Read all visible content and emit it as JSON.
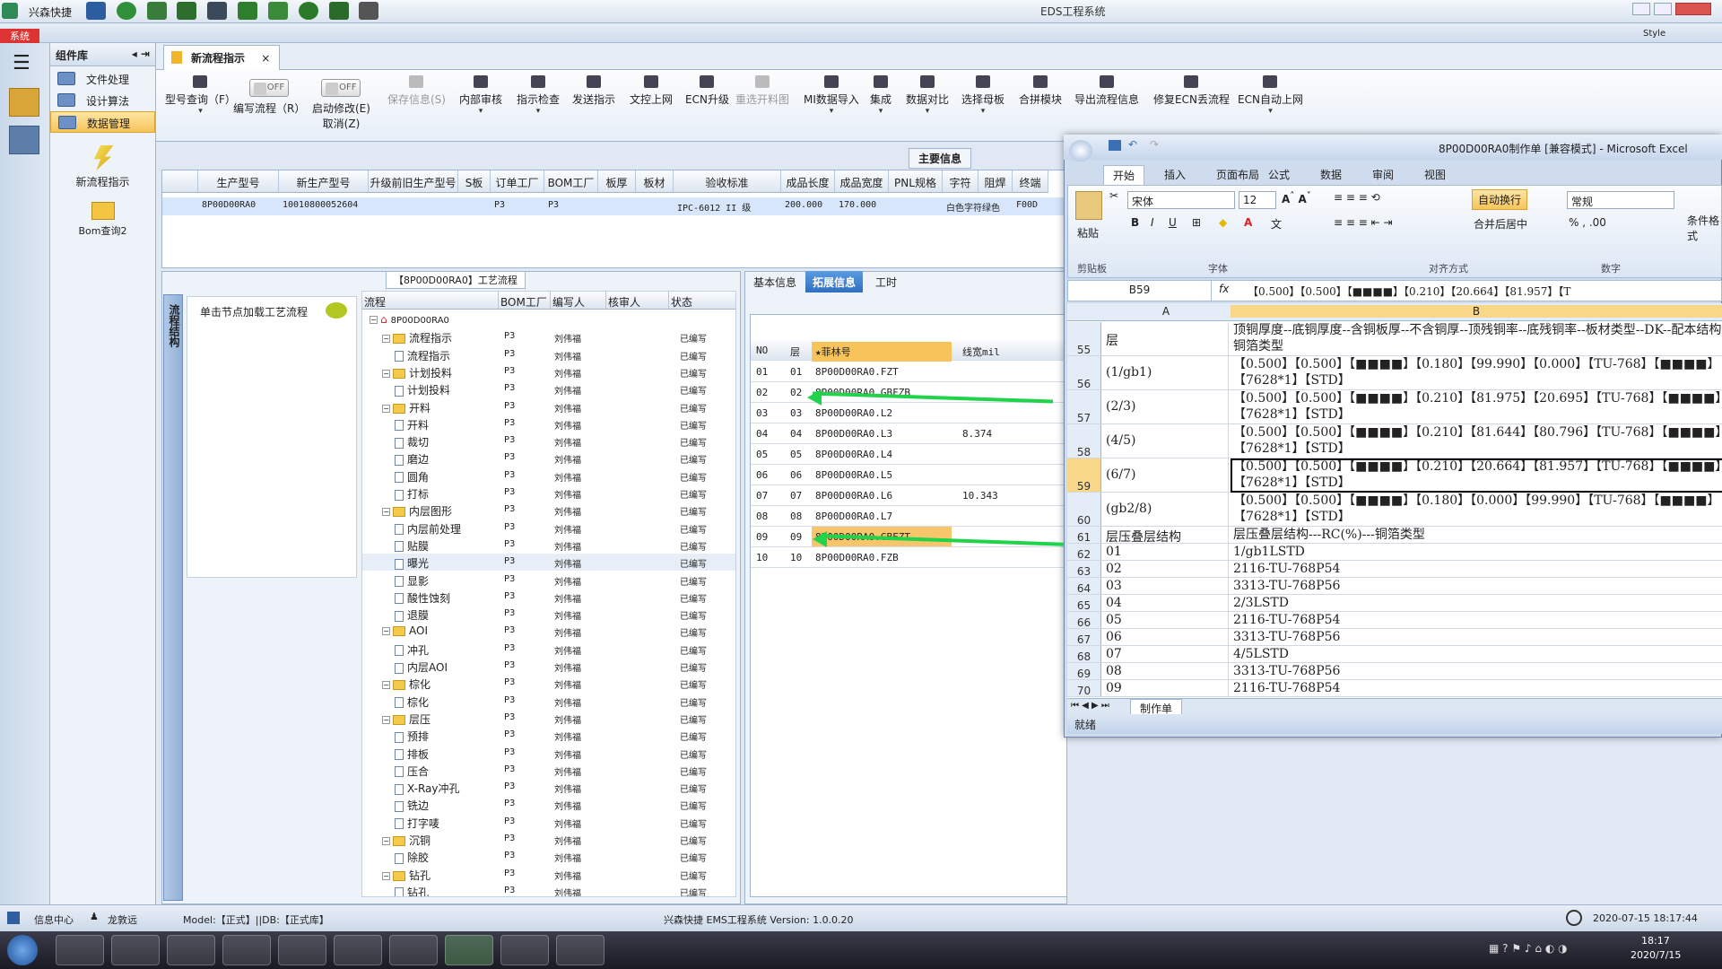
{
  "window": {
    "title": "EDS工程系统",
    "system_tab": "系统",
    "app_name": "兴森快捷",
    "style_label": "Style"
  },
  "component_panel": {
    "title": "组件库",
    "items": [
      {
        "label": "文件处理"
      },
      {
        "label": "设计算法"
      },
      {
        "label": "数据管理"
      }
    ],
    "big_items": [
      {
        "label": "新流程指示"
      },
      {
        "label": "Bom查询2"
      }
    ]
  },
  "doc_tab": {
    "label": "新流程指示"
  },
  "toolbar": {
    "buttons": [
      "型号查询（F）",
      "保存信息(S)",
      "内部审核",
      "指示检查",
      "发送指示",
      "文控上网",
      "ECN升级",
      "重选开料图",
      "MI数据导入",
      "集成",
      "数据对比",
      "选择母板",
      "合拼模块",
      "导出流程信息",
      "修复ECN丢流程",
      "ECN自动上网"
    ],
    "toggle1_label": "编写流程（R）",
    "toggle2_label": "启动修改(E)",
    "toggle2_sub": "取消(Z)",
    "off": "OFF"
  },
  "main_info": {
    "tab": "主要信息",
    "headers": [
      "生产型号",
      "新生产型号",
      "升级前旧生产型号",
      "S板",
      "订单工厂",
      "BOM工厂",
      "板厚",
      "板材",
      "验收标准",
      "成品长度",
      "成品宽度",
      "PNL规格",
      "字符",
      "阻焊",
      "终端"
    ],
    "row": [
      "8P00D00RA0",
      "10010800052604",
      "",
      "",
      "P3",
      "P3",
      "",
      "",
      "IPC-6012 II 级",
      "200.000",
      "170.000",
      "",
      "白色字符",
      "绿色",
      "F00D"
    ]
  },
  "process": {
    "title": "【8P00D00RA0】工艺流程",
    "vtab": "流程结构",
    "load_tip": "单击节点加载工艺流程",
    "headers": [
      "流程",
      "BOM工厂",
      "编写人",
      "核审人",
      "状态"
    ],
    "rows": [
      {
        "name": "8P00D00RA0",
        "lvl": 0,
        "t": "root"
      },
      {
        "name": "流程指示",
        "lvl": 1,
        "t": "f"
      },
      {
        "name": "流程指示",
        "lvl": 2,
        "t": "d"
      },
      {
        "name": "计划投料",
        "lvl": 1,
        "t": "f"
      },
      {
        "name": "计划投料",
        "lvl": 2,
        "t": "d"
      },
      {
        "name": "开料",
        "lvl": 1,
        "t": "f"
      },
      {
        "name": "开料",
        "lvl": 2,
        "t": "d"
      },
      {
        "name": "裁切",
        "lvl": 2,
        "t": "d"
      },
      {
        "name": "磨边",
        "lvl": 2,
        "t": "d"
      },
      {
        "name": "圆角",
        "lvl": 2,
        "t": "d"
      },
      {
        "name": "打标",
        "lvl": 2,
        "t": "d"
      },
      {
        "name": "内层图形",
        "lvl": 1,
        "t": "f"
      },
      {
        "name": "内层前处理",
        "lvl": 2,
        "t": "d"
      },
      {
        "name": "贴膜",
        "lvl": 2,
        "t": "d"
      },
      {
        "name": "曝光",
        "lvl": 2,
        "t": "d"
      },
      {
        "name": "显影",
        "lvl": 2,
        "t": "d"
      },
      {
        "name": "酸性蚀刻",
        "lvl": 2,
        "t": "d"
      },
      {
        "name": "退膜",
        "lvl": 2,
        "t": "d"
      },
      {
        "name": "AOI",
        "lvl": 1,
        "t": "f"
      },
      {
        "name": "冲孔",
        "lvl": 2,
        "t": "d"
      },
      {
        "name": "内层AOI",
        "lvl": 2,
        "t": "d"
      },
      {
        "name": "棕化",
        "lvl": 1,
        "t": "f"
      },
      {
        "name": "棕化",
        "lvl": 2,
        "t": "d"
      },
      {
        "name": "层压",
        "lvl": 1,
        "t": "f"
      },
      {
        "name": "预排",
        "lvl": 2,
        "t": "d"
      },
      {
        "name": "排板",
        "lvl": 2,
        "t": "d"
      },
      {
        "name": "压合",
        "lvl": 2,
        "t": "d"
      },
      {
        "name": "X-Ray冲孔",
        "lvl": 2,
        "t": "d"
      },
      {
        "name": "铣边",
        "lvl": 2,
        "t": "d"
      },
      {
        "name": "打字唛",
        "lvl": 2,
        "t": "d"
      },
      {
        "name": "沉铜",
        "lvl": 1,
        "t": "f"
      },
      {
        "name": "除胶",
        "lvl": 2,
        "t": "d"
      },
      {
        "name": "钻孔",
        "lvl": 1,
        "t": "f"
      },
      {
        "name": "钻孔",
        "lvl": 2,
        "t": "d"
      }
    ],
    "bom": "P3",
    "writer": "刘伟福",
    "status": "已编写"
  },
  "right_tabs": [
    "基本信息",
    "拓展信息",
    "工时"
  ],
  "layer_grid": {
    "headers": [
      "NO",
      "层",
      "★菲林号",
      "线宽mil"
    ],
    "rows": [
      [
        "01",
        "01",
        "8P00D00RA0.FZT",
        ""
      ],
      [
        "02",
        "02",
        "8P00D00RA0.GBFZB",
        ""
      ],
      [
        "03",
        "03",
        "8P00D00RA0.L2",
        ""
      ],
      [
        "04",
        "04",
        "8P00D00RA0.L3",
        "8.374"
      ],
      [
        "05",
        "05",
        "8P00D00RA0.L4",
        ""
      ],
      [
        "06",
        "06",
        "8P00D00RA0.L5",
        ""
      ],
      [
        "07",
        "07",
        "8P00D00RA0.L6",
        "10.343"
      ],
      [
        "08",
        "08",
        "8P00D00RA0.L7",
        ""
      ],
      [
        "09",
        "09",
        "8P00D00RA0.GBFZT",
        ""
      ],
      [
        "10",
        "10",
        "8P00D00RA0.FZB",
        ""
      ]
    ]
  },
  "excel": {
    "title": "8P00D00RA0制作单 [兼容模式] - Microsoft Excel",
    "tabs": [
      "开始",
      "插入",
      "页面布局",
      "公式",
      "数据",
      "审阅",
      "视图"
    ],
    "font": "宋体",
    "size": "12",
    "wrap": "自动换行",
    "merge": "合并后居中",
    "fmt": "常规",
    "groups": [
      "剪贴板",
      "字体",
      "对齐方式",
      "数字"
    ],
    "paste": "粘贴",
    "cond": "条件格式",
    "cell_ref": "B59",
    "formula": "【0.500】【0.500】【■■■■】【0.210】【20.664】【81.957】【T",
    "col_a": "A",
    "col_b": "B",
    "rows": [
      {
        "n": "55",
        "a": "层",
        "b": "顶铜厚度--底铜厚度--含铜板厚--不含铜厚--顶残铜率--底残铜率--板材类型--DK--配本结构--铜箔类型",
        "h": 2
      },
      {
        "n": "56",
        "a": "(1/gb1)",
        "b": "【0.500】【0.500】【■■■■】【0.180】【99.990】【0.000】【TU-768】【■■■■】【7628*1】【STD】",
        "h": 2
      },
      {
        "n": "57",
        "a": "(2/3)",
        "b": "【0.500】【0.500】【■■■■】【0.210】【81.975】【20.695】【TU-768】【■■■■】【7628*1】【STD】",
        "h": 2
      },
      {
        "n": "58",
        "a": "(4/5)",
        "b": "【0.500】【0.500】【■■■■】【0.210】【81.644】【80.796】【TU-768】【■■■■】【7628*1】【STD】",
        "h": 2
      },
      {
        "n": "59",
        "a": "(6/7)",
        "b": "【0.500】【0.500】【■■■■】【0.210】【20.664】【81.957】【TU-768】【■■■■】【7628*1】【STD】",
        "h": 2
      },
      {
        "n": "60",
        "a": "(gb2/8)",
        "b": "【0.500】【0.500】【■■■■】【0.180】【0.000】【99.990】【TU-768】【■■■■】【7628*1】【STD】",
        "h": 2
      },
      {
        "n": "61",
        "a": "层压叠层结构",
        "b": "层压叠层结构---RC(%)---铜箔类型",
        "h": 1
      },
      {
        "n": "62",
        "a": "01",
        "b": "1/gb1LSTD",
        "h": 1
      },
      {
        "n": "63",
        "a": "02",
        "b": "2116-TU-768P54",
        "h": 1
      },
      {
        "n": "64",
        "a": "03",
        "b": "3313-TU-768P56",
        "h": 1
      },
      {
        "n": "65",
        "a": "04",
        "b": "2/3LSTD",
        "h": 1
      },
      {
        "n": "66",
        "a": "05",
        "b": "2116-TU-768P54",
        "h": 1
      },
      {
        "n": "67",
        "a": "06",
        "b": "3313-TU-768P56",
        "h": 1
      },
      {
        "n": "68",
        "a": "07",
        "b": "4/5LSTD",
        "h": 1
      },
      {
        "n": "69",
        "a": "08",
        "b": "3313-TU-768P56",
        "h": 1
      },
      {
        "n": "70",
        "a": "09",
        "b": "2116-TU-768P54",
        "h": 1
      }
    ],
    "sheet": "制作单",
    "status": "就绪"
  },
  "status": {
    "info": "信息中心",
    "user": "龙敦远",
    "model": "Model:【正式】||DB:【正式库】",
    "ver": "兴森快捷 EMS工程系统 Version: 1.0.0.20",
    "datetime": "2020-07-15 18:17:44"
  },
  "taskbar": {
    "time": "18:17",
    "date": "2020/7/15"
  }
}
